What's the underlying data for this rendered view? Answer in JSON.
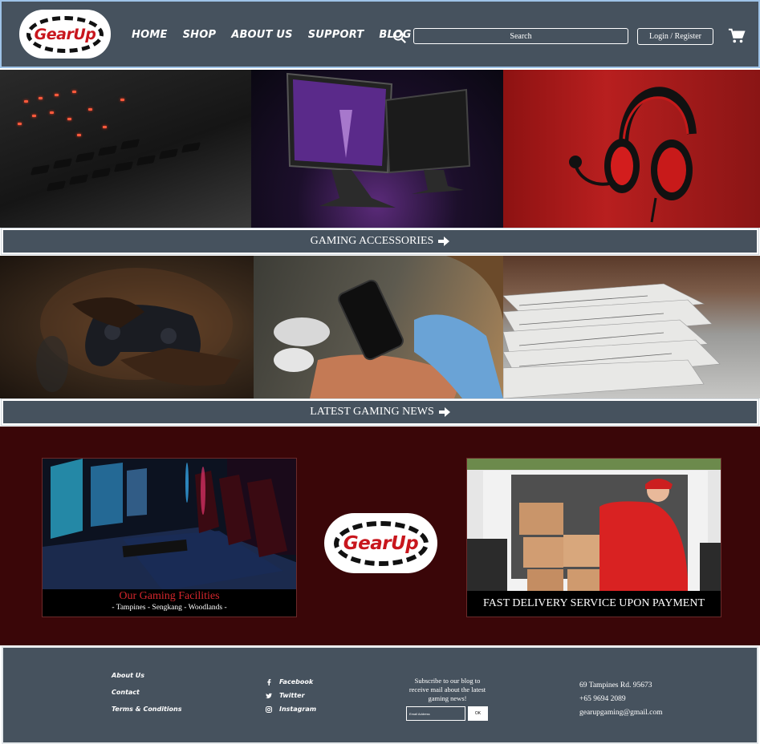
{
  "brand": {
    "name": "GearUp"
  },
  "nav": {
    "items": [
      "HOME",
      "SHOP",
      "ABOUT US",
      "SUPPORT",
      "BLOG"
    ]
  },
  "header": {
    "search_placeholder": "Search",
    "login_label": "Login / Register"
  },
  "sections": {
    "accessories_label": "GAMING ACCESSORIES",
    "news_label": "LATEST GAMING NEWS"
  },
  "features": {
    "facilities_title": "Our Gaming Facilities",
    "facilities_locations": "- Tampines - Sengkang - Woodlands -",
    "delivery_title": "FAST DELIVERY SERVICE UPON PAYMENT"
  },
  "footer": {
    "links": [
      "About Us",
      "Contact",
      "Terms & Conditions"
    ],
    "social": [
      {
        "label": "Facebook",
        "icon": "facebook-icon"
      },
      {
        "label": "Twitter",
        "icon": "twitter-icon"
      },
      {
        "label": "Instagram",
        "icon": "instagram-icon"
      }
    ],
    "subscribe_text": "Subscribe to our blog to receive mail about the latest gaming news!",
    "email_placeholder": "Email Address",
    "ok_label": "OK",
    "address": "69 Tampines Rd. 95673",
    "phone": "+65 9694 2089",
    "email": "gearupgaming@gmail.com"
  },
  "colors": {
    "header_bg": "#46525e",
    "maroon_bg": "#3a0608",
    "brand_red": "#c8161d",
    "header_outline": "#9ec3e8"
  }
}
